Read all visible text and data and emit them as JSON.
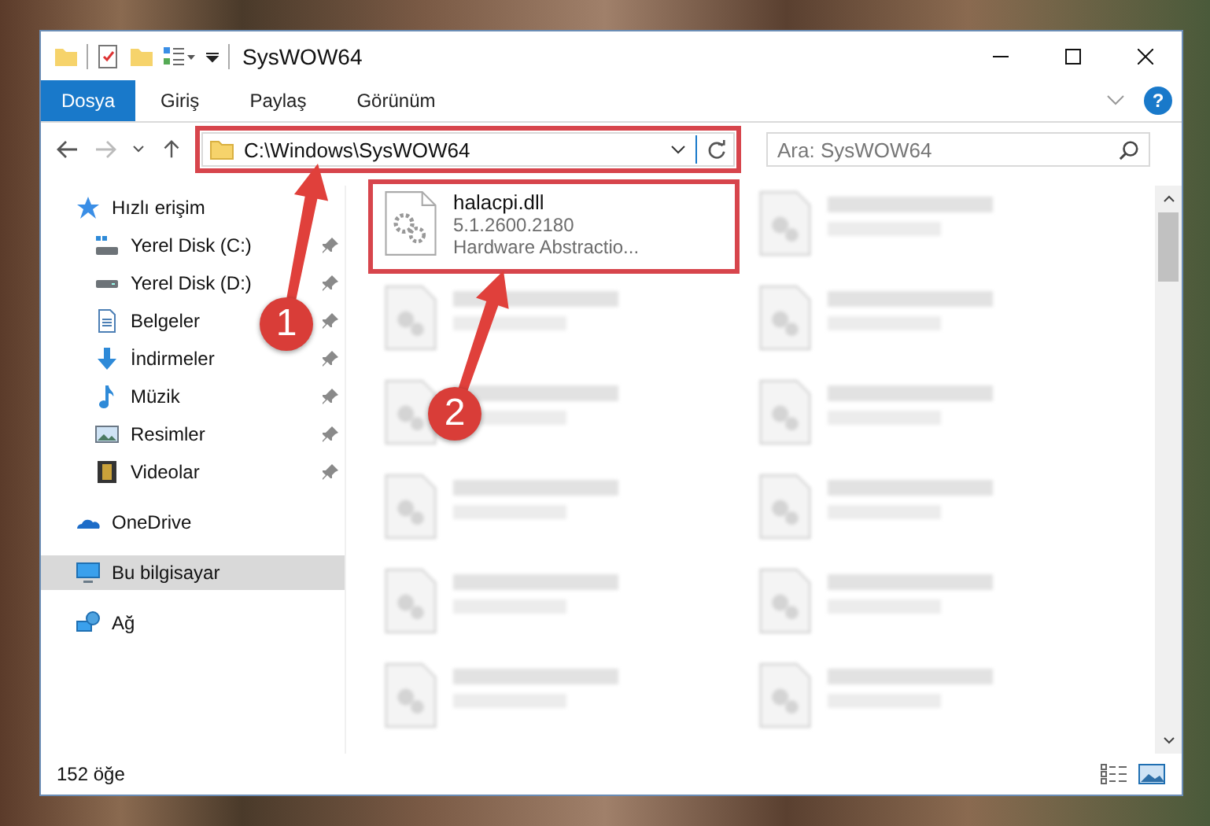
{
  "window": {
    "title": "SysWOW64"
  },
  "ribbon_tabs": [
    {
      "label": "Dosya",
      "selected": true
    },
    {
      "label": "Giriş",
      "selected": false
    },
    {
      "label": "Paylaş",
      "selected": false
    },
    {
      "label": "Görünüm",
      "selected": false
    }
  ],
  "address_bar": {
    "path": "C:\\Windows\\SysWOW64",
    "highlighted": true
  },
  "search": {
    "placeholder": "Ara: SysWOW64"
  },
  "sidebar": {
    "items": [
      {
        "label": "Hızlı erişim",
        "kind": "star",
        "selected": false,
        "children": [
          {
            "label": "Yerel Disk (C:)",
            "kind": "system-drive",
            "pinned": true,
            "selected": false
          },
          {
            "label": "Yerel Disk (D:)",
            "kind": "drive",
            "pinned": true,
            "selected": false
          },
          {
            "label": "Belgeler",
            "kind": "documents",
            "pinned": true,
            "selected": false
          },
          {
            "label": "İndirmeler",
            "kind": "download",
            "pinned": true,
            "selected": false
          },
          {
            "label": "Müzik",
            "kind": "music",
            "pinned": true,
            "selected": false
          },
          {
            "label": "Resimler",
            "kind": "pictures",
            "pinned": true,
            "selected": false
          },
          {
            "label": "Videolar",
            "kind": "videos",
            "pinned": true,
            "selected": false
          }
        ]
      },
      {
        "label": "OneDrive",
        "kind": "cloud",
        "selected": false
      },
      {
        "label": "Bu bilgisayar",
        "kind": "computer",
        "selected": true
      },
      {
        "label": "Ağ",
        "kind": "network",
        "selected": false
      }
    ]
  },
  "help_button": {
    "label": "?"
  },
  "files": [
    {
      "kind": "file",
      "name": "halacpi.dll",
      "details": [
        "5.1.2600.2180",
        "Hardware Abstractio..."
      ],
      "highlighted": true
    },
    {
      "kind": "blurred"
    },
    {
      "kind": "blurred"
    },
    {
      "kind": "blurred"
    },
    {
      "kind": "blurred"
    },
    {
      "kind": "blurred"
    },
    {
      "kind": "blurred"
    },
    {
      "kind": "blurred"
    },
    {
      "kind": "blurred"
    },
    {
      "kind": "blurred"
    },
    {
      "kind": "blurred"
    },
    {
      "kind": "blurred"
    }
  ],
  "status_bar": {
    "item_count": "152 öğe"
  },
  "callouts": [
    {
      "number": "1"
    },
    {
      "number": "2"
    }
  ]
}
